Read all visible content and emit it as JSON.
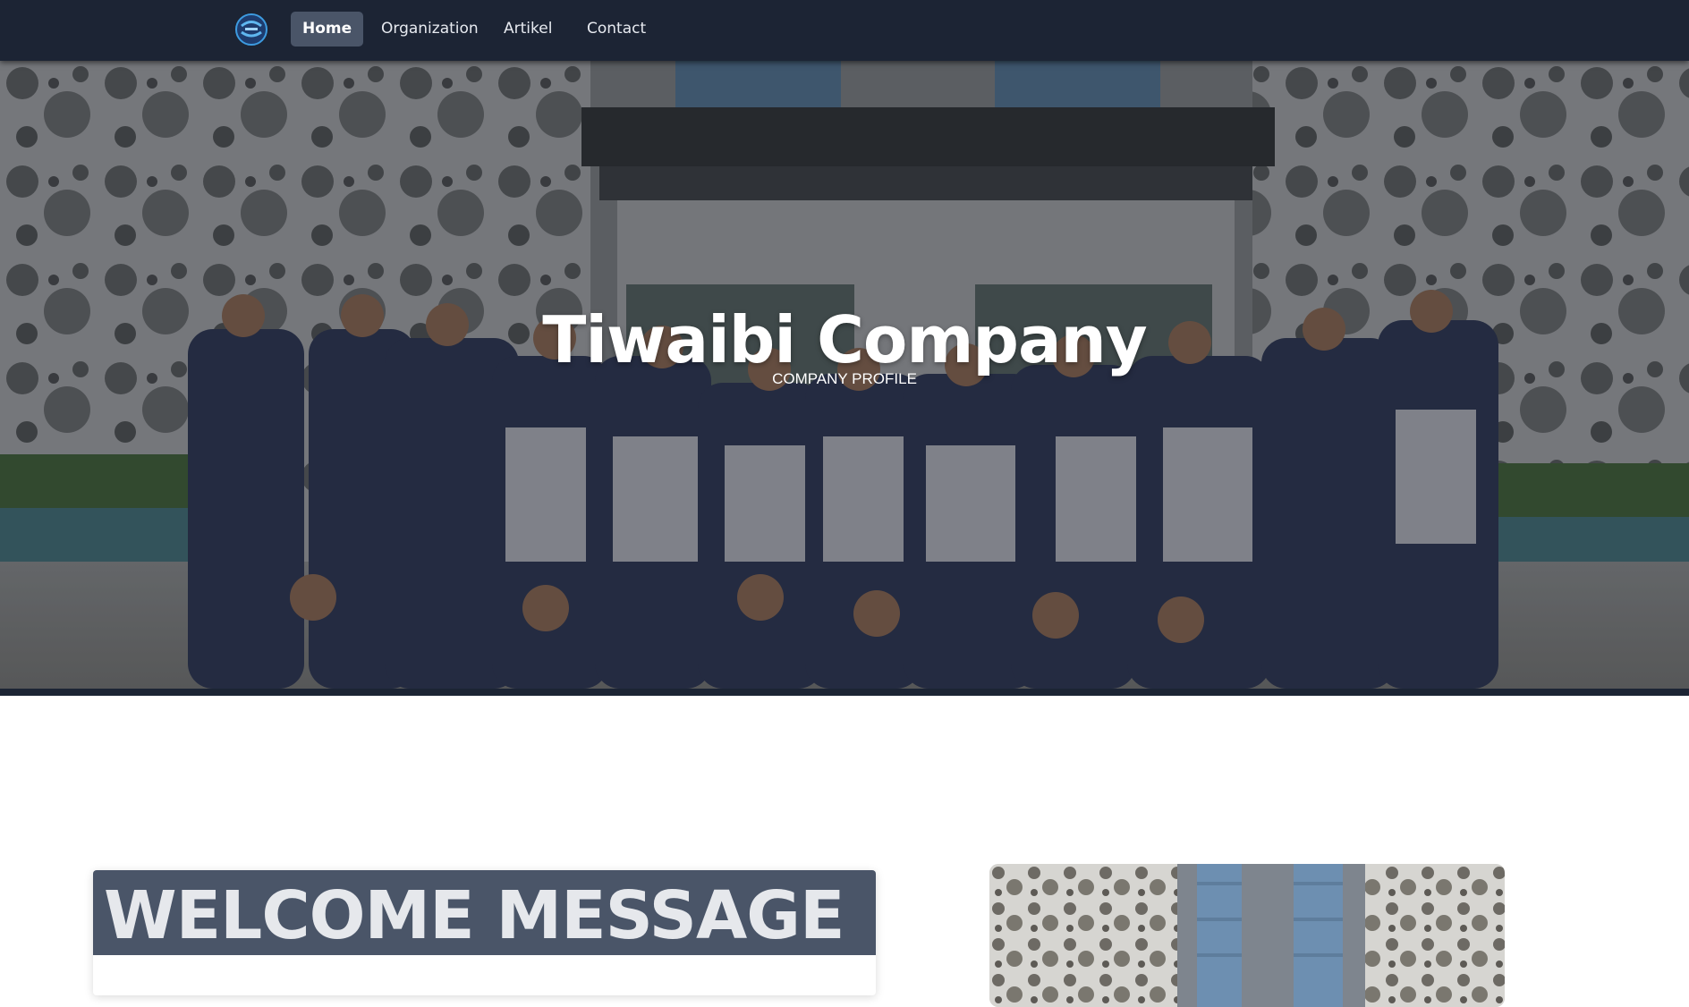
{
  "navbar": {
    "logo_icon": "tiwaibi-logo-icon",
    "items": [
      {
        "label": "Home",
        "active": true
      },
      {
        "label": "Organization",
        "active": false
      },
      {
        "label": "Artikel",
        "active": false
      },
      {
        "label": "Contact",
        "active": false
      }
    ]
  },
  "hero": {
    "title": "Tiwaibi Company",
    "subtitle": "COMPANY PROFILE",
    "image": "group-photo-in-front-of-building"
  },
  "welcome": {
    "title": "WELCOME MESSAGE",
    "text": "",
    "side_image": "building-facade-photo"
  },
  "colors": {
    "navbar": "#1c2434",
    "nav_active": "#4a5568",
    "welcome_header": "#4a5568",
    "page_background": "#ffffff"
  }
}
